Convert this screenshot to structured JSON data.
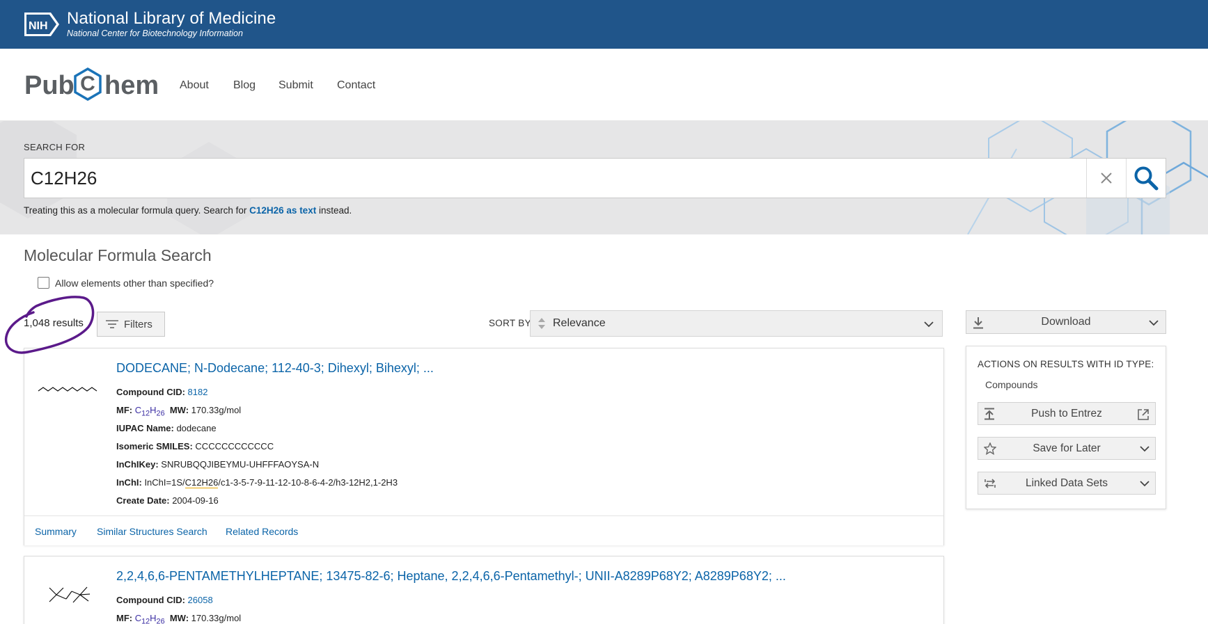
{
  "header": {
    "org_title": "National Library of Medicine",
    "org_subtitle": "National Center for Biotechnology Information",
    "nih_logo_text": "NIH"
  },
  "pubchem": {
    "logo_pub": "Pub",
    "logo_c": "C",
    "logo_hem": "hem",
    "nav": [
      "About",
      "Blog",
      "Submit",
      "Contact"
    ]
  },
  "search": {
    "label": "SEARCH FOR",
    "value": "C12H26",
    "hint_prefix": "Treating this as a molecular formula query. Search for ",
    "hint_link": "C12H26 as text",
    "hint_suffix": " instead."
  },
  "page": {
    "title": "Molecular Formula Search",
    "allow_label": "Allow elements other than specified?",
    "allow_checked": false,
    "results_count": "1,048 results",
    "filters_label": "Filters",
    "sort_by_label": "SORT BY",
    "sort_value": "Relevance"
  },
  "sidebar": {
    "download_label": "Download",
    "actions_title": "ACTIONS ON RESULTS WITH ID TYPE:",
    "id_type": "Compounds",
    "push_label": "Push to Entrez",
    "save_label": "Save for Later",
    "linked_label": "Linked Data Sets"
  },
  "results": [
    {
      "title": "DODECANE; N-Dodecane; 112-40-3; Dihexyl; Bihexyl; ...",
      "cid_label": "Compound CID: ",
      "cid": "8182",
      "mf_label": "MF: ",
      "mf_c": "C",
      "mf_c_sub": "12",
      "mf_h": "H",
      "mf_h_sub": "26",
      "mw_label": "MW: ",
      "mw": "170.33g/mol",
      "iupac_label": "IUPAC Name: ",
      "iupac": "dodecane",
      "smiles_label": "Isomeric SMILES: ",
      "smiles": "CCCCCCCCCCCC",
      "inchikey_label": "InChIKey: ",
      "inchikey": "SNRUBQQJIBEYMU-UHFFFAOYSA-N",
      "inchi_label": "InChI: ",
      "inchi_prefix": "InChI=1S/",
      "inchi_formula": "C12H26",
      "inchi_suffix": "/c1-3-5-7-9-11-12-10-8-6-4-2/h3-12H2,1-2H3",
      "date_label": "Create Date: ",
      "date": "2004-09-16",
      "links": [
        "Summary",
        "Similar Structures Search",
        "Related Records"
      ]
    },
    {
      "title": "2,2,4,6,6-PENTAMETHYLHEPTANE; 13475-82-6; Heptane, 2,2,4,6,6-Pentamethyl-; UNII-A8289P68Y2; A8289P68Y2; ...",
      "cid_label": "Compound CID: ",
      "cid": "26058",
      "mf_label": "MF: ",
      "mf_c": "C",
      "mf_c_sub": "12",
      "mf_h": "H",
      "mf_h_sub": "26",
      "mw_label": "MW: ",
      "mw": "170.33g/mol"
    }
  ],
  "colors": {
    "nih_blue": "#20558a",
    "link_blue": "#0b64a8",
    "annotation_purple": "#5b1a8a"
  }
}
